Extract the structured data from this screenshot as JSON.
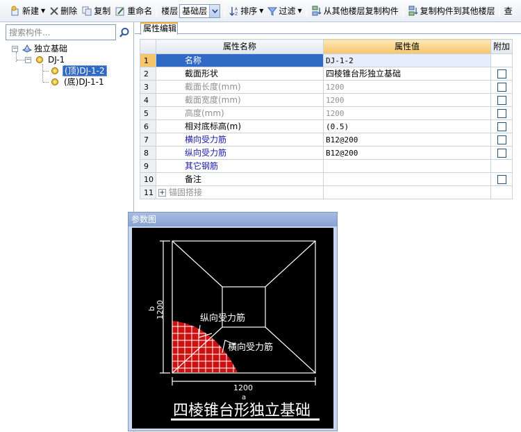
{
  "toolbar": {
    "new_label": "新建",
    "delete_label": "删除",
    "copy_label": "复制",
    "rename_label": "重命名",
    "floor_label": "楼层",
    "floor_value": "基础层",
    "sort_label": "排序",
    "filter_label": "过滤",
    "copy_from_floor_label": "从其他楼层复制构件",
    "copy_to_floor_label": "复制构件到其他楼层",
    "trailing_label": "查"
  },
  "left_panel": {
    "search_placeholder": "搜索构件...",
    "tree": {
      "root": "独立基础",
      "group": "DJ-1",
      "children": [
        "(顶)DJ-1-2",
        "(底)DJ-1-1"
      ],
      "selected_index": 0
    }
  },
  "right_panel": {
    "tab_label": "属性编辑",
    "columns": [
      "属性名称",
      "属性值",
      "附加"
    ],
    "rows": [
      {
        "num": "1",
        "name": "名称",
        "value": "DJ-1-2",
        "name_style": "normal",
        "checkbox": false
      },
      {
        "num": "2",
        "name": "截面形状",
        "value": "四棱锥台形独立基础",
        "name_style": "normal",
        "checkbox": true
      },
      {
        "num": "3",
        "name": "截面长度(mm)",
        "value": "1200",
        "name_style": "gray",
        "checkbox": true
      },
      {
        "num": "4",
        "name": "截面宽度(mm)",
        "value": "1200",
        "name_style": "gray",
        "checkbox": true
      },
      {
        "num": "5",
        "name": "高度(mm)",
        "value": "1200",
        "name_style": "gray",
        "checkbox": true
      },
      {
        "num": "6",
        "name": "相对底标高(m)",
        "value": "(0.5)",
        "name_style": "normal",
        "checkbox": true
      },
      {
        "num": "7",
        "name": "横向受力筋",
        "value": "B12@200",
        "name_style": "blue",
        "checkbox": true
      },
      {
        "num": "8",
        "name": "纵向受力筋",
        "value": "B12@200",
        "name_style": "blue",
        "checkbox": true
      },
      {
        "num": "9",
        "name": "其它钢筋",
        "value": "",
        "name_style": "blue",
        "checkbox": false
      },
      {
        "num": "10",
        "name": "备注",
        "value": "",
        "name_style": "normal",
        "checkbox": true
      },
      {
        "num": "11",
        "name": "锚固搭接",
        "value": "",
        "name_style": "gray",
        "checkbox": false,
        "expander": "+"
      }
    ]
  },
  "param_window": {
    "title": "参数图",
    "diagram": {
      "dim_b_letter": "b",
      "dim_b_value": "1200",
      "dim_a_value": "1200",
      "dim_a_letter": "a",
      "label_longitudinal": "纵向受力筋",
      "label_transverse": "横向受力筋",
      "caption": "四棱锥台形独立基础"
    }
  },
  "colors": {
    "selection": "#316ac5",
    "header_highlight": "#f6c46a",
    "rebar_red": "#cc1111",
    "canvas": "#000000"
  }
}
